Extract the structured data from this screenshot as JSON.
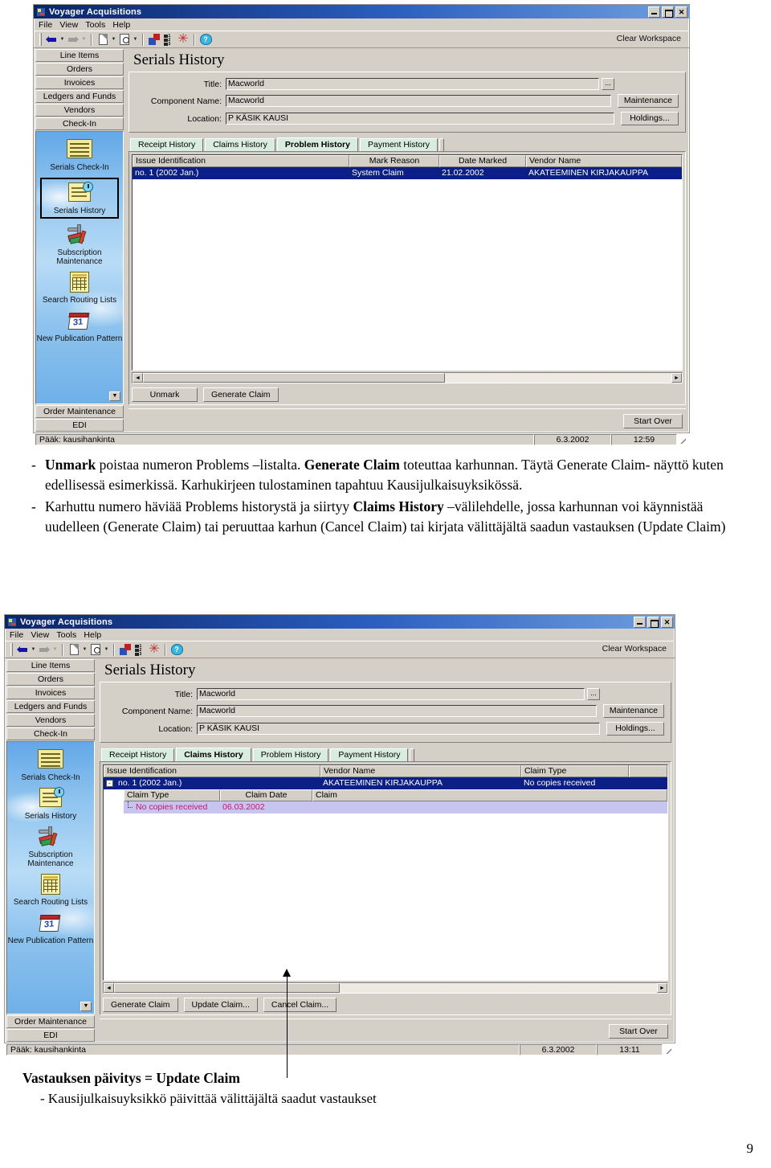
{
  "document": {
    "page_number": "9",
    "paragraphs": [
      {
        "bullet": "-",
        "runs": [
          {
            "text": "Unmark",
            "bold": true
          },
          {
            "text": " poistaa numeron Problems –listalta. ",
            "bold": false
          },
          {
            "text": "Generate Claim",
            "bold": true
          },
          {
            "text": " toteuttaa karhunnan. Täytä Generate Claim- näyttö kuten edellisessä esimerkissä. Karhukirjeen tulostaminen tapahtuu Kausijulkaisuyksikössä.",
            "bold": false
          }
        ]
      },
      {
        "bullet": "-",
        "runs": [
          {
            "text": "Karhuttu numero häviää Problems historystä ja siirtyy ",
            "bold": false
          },
          {
            "text": "Claims History",
            "bold": true
          },
          {
            "text": " –välilehdelle, jossa karhunnan voi käynnistää uudelleen (Generate Claim) tai peruuttaa karhun (Cancel Claim) tai kirjata välittäjältä saadun vastauksen (Update Claim)",
            "bold": false
          }
        ]
      }
    ],
    "caption": {
      "heading": "Vastauksen päivitys = Update Claim",
      "sub": "- Kausijulkaisuyksikkö päivittää välittäjältä saadut vastaukset"
    }
  },
  "window1": {
    "title": "Voyager Acquisitions",
    "window_buttons": {
      "minimize": "_",
      "maximize": "□",
      "close": "✕"
    },
    "menu": [
      "File",
      "View",
      "Tools",
      "Help"
    ],
    "toolbar": {
      "clear_workspace": "Clear Workspace",
      "icons": [
        "back-arrow-icon",
        "forward-arrow-icon",
        "new-document-icon",
        "search-preview-icon",
        "import-icon",
        "barcode-icon",
        "asterisk-icon",
        "help-icon"
      ]
    },
    "sidebar": {
      "top_buttons": [
        "Line Items",
        "Orders",
        "Invoices",
        "Ledgers and Funds",
        "Vendors",
        "Check-In"
      ],
      "items": [
        {
          "label": "Serials Check-In",
          "selected": false
        },
        {
          "label": "Serials History",
          "selected": true
        },
        {
          "label": "Subscription Maintenance",
          "selected": false
        },
        {
          "label": "Search Routing Lists",
          "selected": false
        },
        {
          "label": "New Publication Pattern",
          "selected": false
        }
      ],
      "bottom_buttons": [
        "Order Maintenance",
        "EDI"
      ]
    },
    "page_title": "Serials History",
    "form": {
      "title_label": "Title:",
      "title_value": "Macworld",
      "browse_button": "...",
      "component_label": "Component Name:",
      "component_value": "Macworld",
      "maintenance_button": "Maintenance",
      "location_label": "Location:",
      "location_value": "P KÄSIK KAUSI",
      "holdings_button": "Holdings..."
    },
    "tabs": [
      {
        "label": "Receipt History",
        "active": false
      },
      {
        "label": "Claims History",
        "active": false
      },
      {
        "label": "Problem History",
        "active": true
      },
      {
        "label": "Payment History",
        "active": false
      }
    ],
    "grid": {
      "columns": [
        "Issue Identification",
        "Mark Reason",
        "Date Marked",
        "Vendor Name"
      ],
      "rows": [
        {
          "selected": true,
          "cells": [
            "no. 1 (2002 Jan.)",
            "System Claim",
            "21.02.2002",
            "AKATEEMINEN KIRJAKAUPPA"
          ]
        }
      ]
    },
    "buttons": [
      "Unmark",
      "Generate Claim"
    ],
    "start_over": "Start Over",
    "status": {
      "user": "Pääk: kausihankinta",
      "date": "6.3.2002",
      "time": "12:59"
    }
  },
  "window2": {
    "title": "Voyager Acquisitions",
    "window_buttons": {
      "minimize": "_",
      "maximize": "□",
      "close": "✕"
    },
    "menu": [
      "File",
      "View",
      "Tools",
      "Help"
    ],
    "toolbar": {
      "clear_workspace": "Clear Workspace",
      "icons": [
        "back-arrow-icon",
        "forward-arrow-icon",
        "new-document-icon",
        "search-preview-icon",
        "import-icon",
        "barcode-icon",
        "asterisk-icon",
        "help-icon"
      ]
    },
    "sidebar": {
      "top_buttons": [
        "Line Items",
        "Orders",
        "Invoices",
        "Ledgers and Funds",
        "Vendors",
        "Check-In"
      ],
      "items": [
        {
          "label": "Serials Check-In",
          "selected": false
        },
        {
          "label": "Serials History",
          "selected": false
        },
        {
          "label": "Subscription Maintenance",
          "selected": false
        },
        {
          "label": "Search Routing Lists",
          "selected": false
        },
        {
          "label": "New Publication Pattern",
          "selected": false
        }
      ],
      "bottom_buttons": [
        "Order Maintenance",
        "EDI"
      ]
    },
    "page_title": "Serials History",
    "form": {
      "title_label": "Title:",
      "title_value": "Macworld",
      "browse_button": "...",
      "component_label": "Component Name:",
      "component_value": "Macworld",
      "maintenance_button": "Maintenance",
      "location_label": "Location:",
      "location_value": "P KÄSIK KAUSI",
      "holdings_button": "Holdings..."
    },
    "tabs": [
      {
        "label": "Receipt History",
        "active": false
      },
      {
        "label": "Claims History",
        "active": true
      },
      {
        "label": "Problem History",
        "active": false
      },
      {
        "label": "Payment History",
        "active": false
      }
    ],
    "grid": {
      "columns": [
        "Issue Identification",
        "Vendor Name",
        "Claim Type"
      ],
      "rows": [
        {
          "selected": true,
          "expander": "-",
          "cells": [
            "no. 1 (2002 Jan.)",
            "AKATEEMINEN KIRJAKAUPPA",
            "No copies received"
          ]
        }
      ],
      "sub_columns": [
        "Claim Type",
        "Claim Date",
        "Claim"
      ],
      "sub_rows": [
        {
          "cells": [
            "No copies received",
            "06.03.2002",
            ""
          ]
        }
      ]
    },
    "buttons": [
      "Generate Claim",
      "Update Claim...",
      "Cancel Claim..."
    ],
    "start_over": "Start Over",
    "status": {
      "user": "Pääk: kausihankinta",
      "date": "6.3.2002",
      "time": "13:11"
    }
  }
}
